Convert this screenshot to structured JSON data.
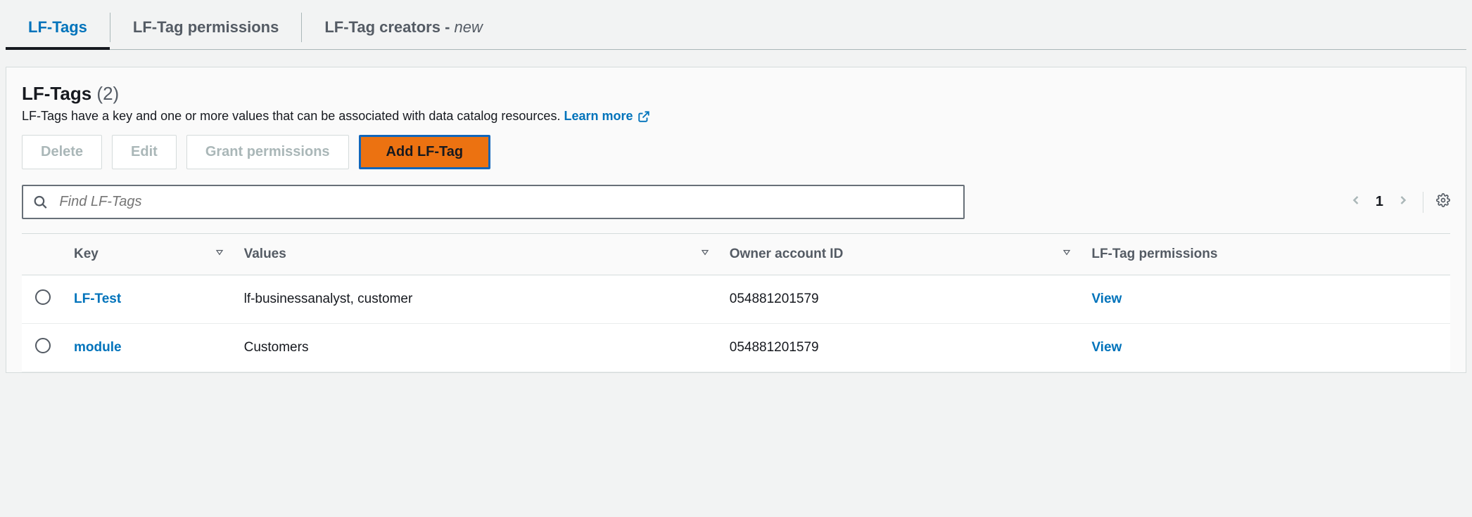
{
  "tabs": {
    "lftags": "LF-Tags",
    "permissions": "LF-Tag permissions",
    "creators_prefix": "LF-Tag creators - ",
    "creators_badge": "new"
  },
  "panel": {
    "title": "LF-Tags",
    "count": "(2)",
    "description": "LF-Tags have a key and one or more values that can be associated with data catalog resources.",
    "learn_more": "Learn more"
  },
  "toolbar": {
    "delete": "Delete",
    "edit": "Edit",
    "grant": "Grant permissions",
    "add": "Add LF-Tag"
  },
  "search": {
    "placeholder": "Find LF-Tags"
  },
  "pagination": {
    "page": "1"
  },
  "columns": {
    "key": "Key",
    "values": "Values",
    "owner": "Owner account ID",
    "permissions": "LF-Tag permissions"
  },
  "rows": [
    {
      "key": "LF-Test",
      "values": "lf-businessanalyst, customer",
      "owner": "054881201579",
      "permissions": "View"
    },
    {
      "key": "module",
      "values": "Customers",
      "owner": "054881201579",
      "permissions": "View"
    }
  ]
}
